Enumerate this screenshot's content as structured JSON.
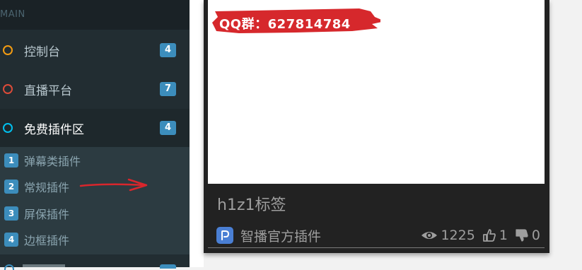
{
  "sidebar": {
    "section_header": "MAIN",
    "items": [
      {
        "label": "控制台",
        "badge": "4",
        "color": "#f39c12"
      },
      {
        "label": "直播平台",
        "badge": "7",
        "color": "#dd4b39"
      },
      {
        "label": "免费插件区",
        "badge": "4",
        "color": "#00c0ef"
      }
    ],
    "submenu": [
      {
        "num": "1",
        "label": "弹幕类插件"
      },
      {
        "num": "2",
        "label": "常规插件"
      },
      {
        "num": "3",
        "label": "屏保插件"
      },
      {
        "num": "4",
        "label": "边框插件"
      }
    ]
  },
  "card": {
    "banner_text": "QQ群：627814784",
    "title": "h1z1标签",
    "author": "智播官方插件",
    "views": "1225",
    "likes": "1",
    "dislikes": "0"
  },
  "colors": {
    "sidebar_bg": "#222d32",
    "accent_blue": "#3c8dbc",
    "banner_red": "#d6282c",
    "arrow_red": "#d9262c"
  }
}
